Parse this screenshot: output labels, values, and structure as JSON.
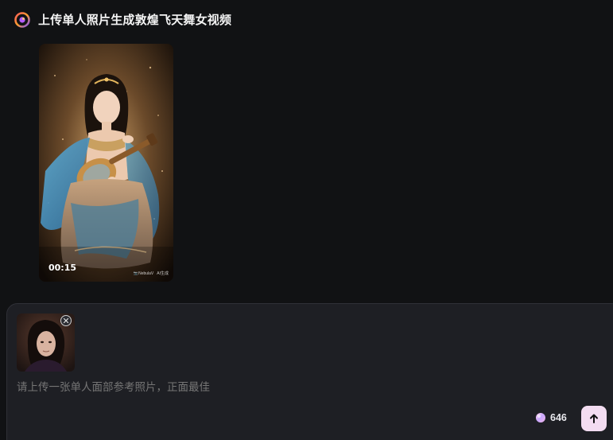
{
  "header": {
    "logo_icon": "app-logo-icon",
    "title": "上传单人照片生成敦煌飞天舞女视频"
  },
  "video": {
    "duration": "00:15",
    "watermark_left": "📷NebulaV",
    "watermark_right": "AI生成",
    "thumbnail": "dancer-with-pipa-image"
  },
  "composer": {
    "attachment_image": "portrait-photo",
    "remove_icon": "close-icon",
    "placeholder": "请上传一张单人面部参考照片，正面最佳",
    "credits_icon": "gem-icon",
    "credits_value": "646",
    "send_icon": "arrow-up-icon"
  },
  "colors": {
    "background": "#111214",
    "composer_bg": "#1e1f24",
    "send_button": "#f3dcf1"
  }
}
